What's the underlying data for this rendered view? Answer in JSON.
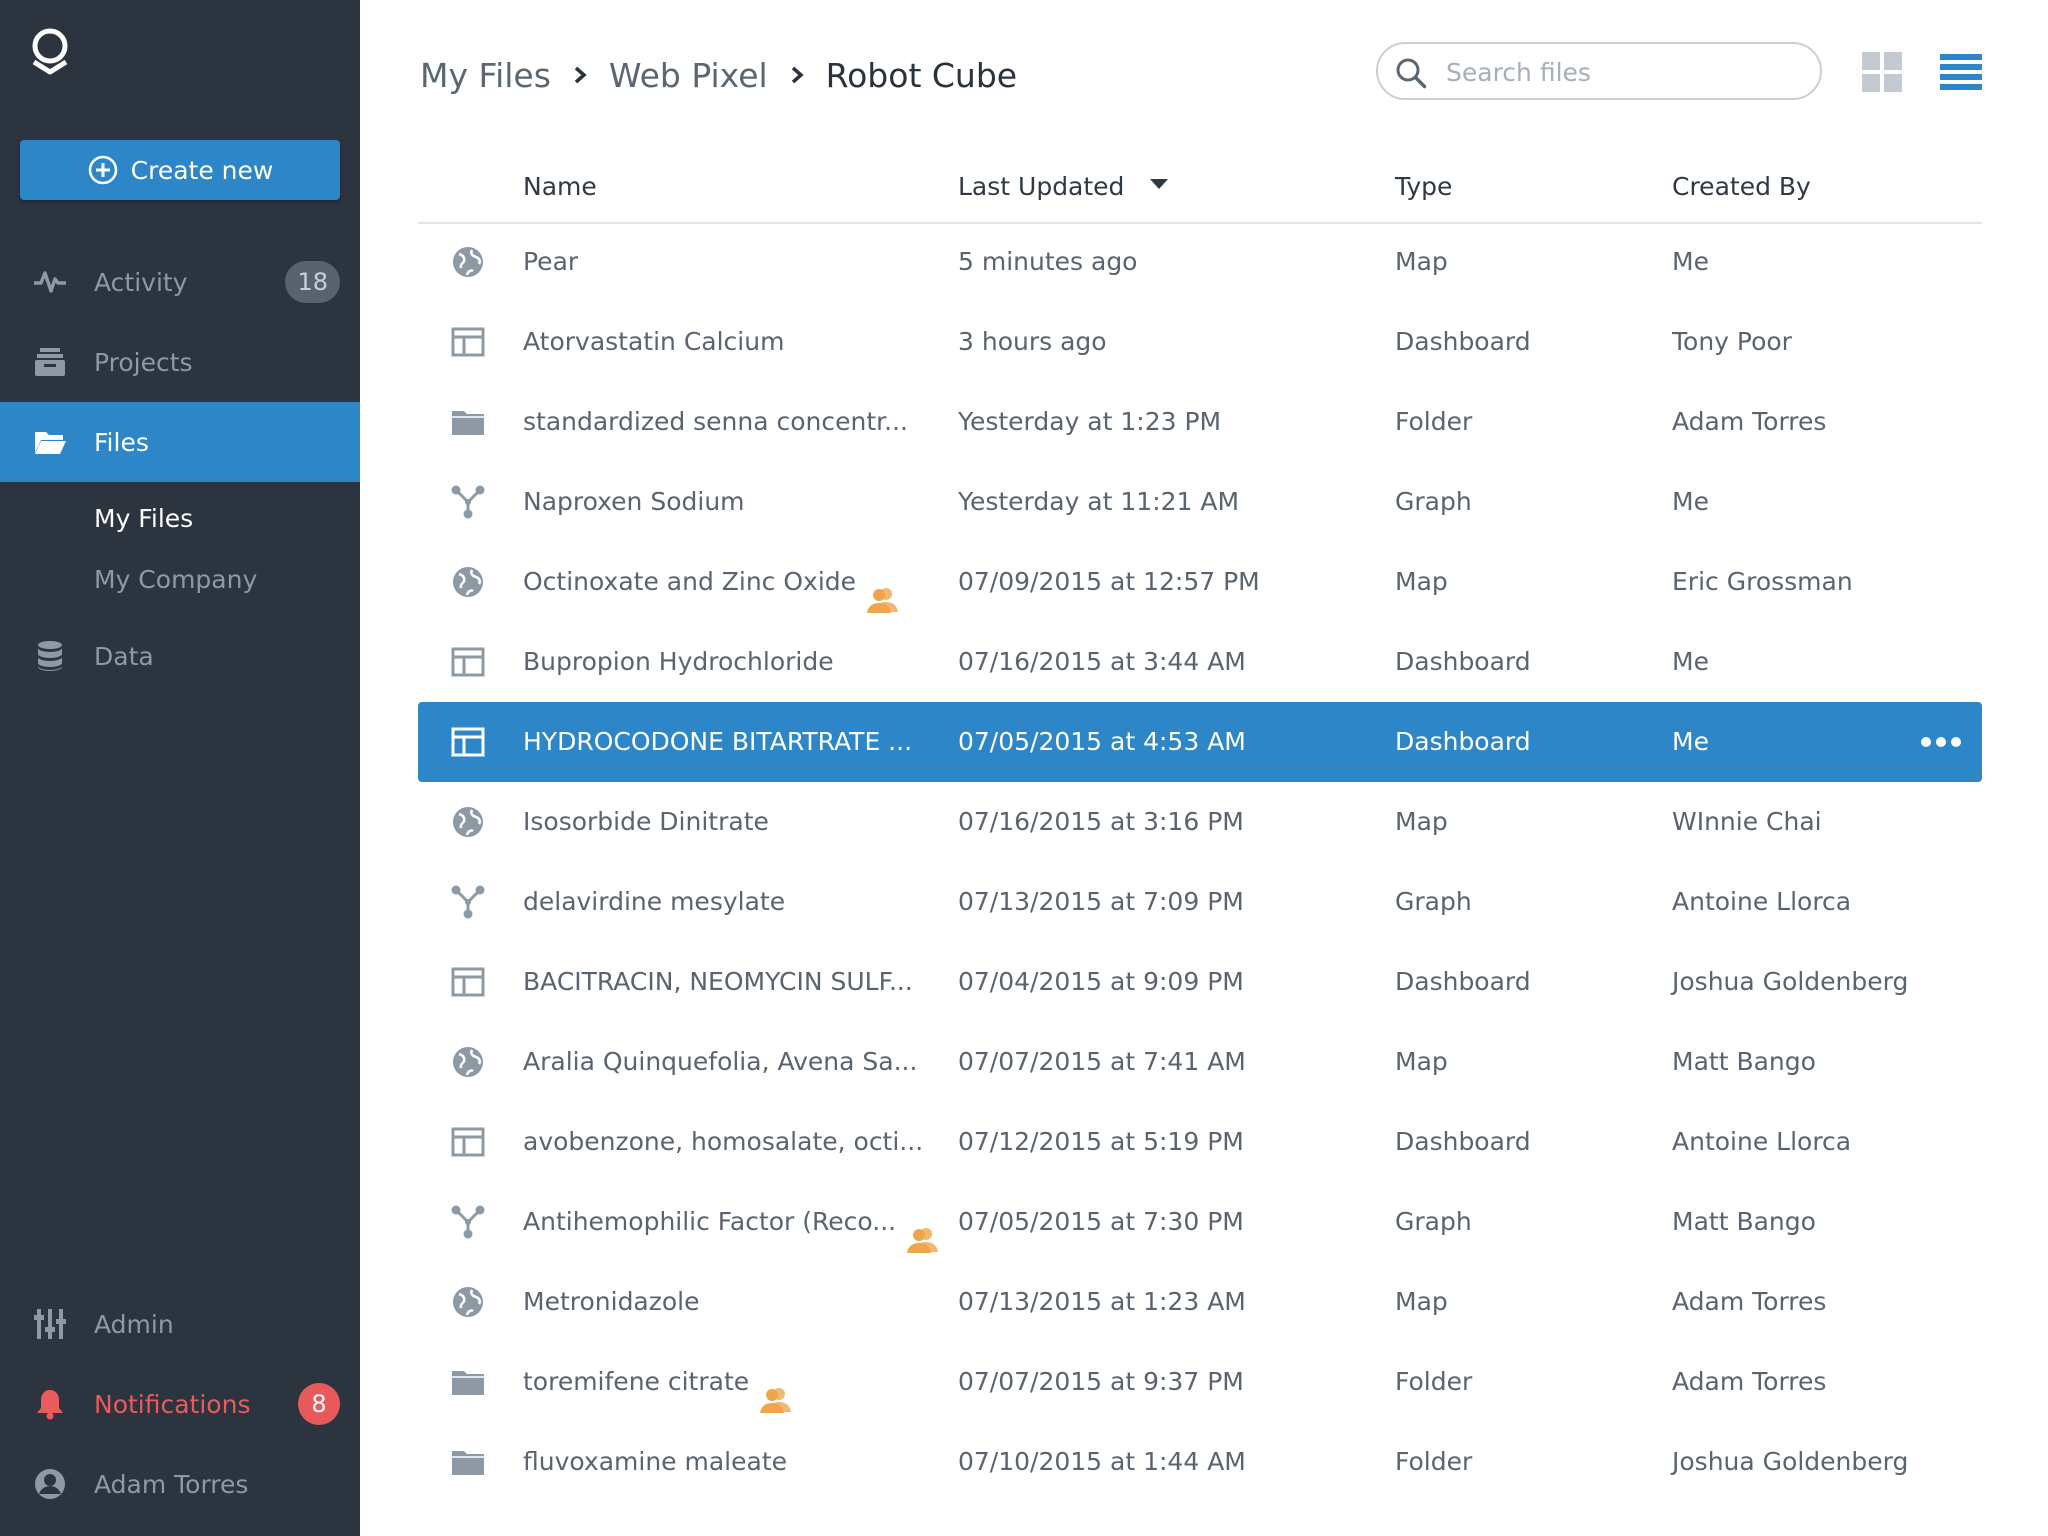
{
  "sidebar": {
    "create_label": "Create new",
    "nav": [
      {
        "label": "Activity",
        "icon": "pulse-icon",
        "badge": "18"
      },
      {
        "label": "Projects",
        "icon": "projects-icon"
      },
      {
        "label": "Files",
        "icon": "folder-open-icon",
        "active": true
      },
      {
        "label": "Data",
        "icon": "database-icon"
      }
    ],
    "files_sub": [
      {
        "label": "My Files",
        "current": true
      },
      {
        "label": "My Company"
      }
    ],
    "bottom": [
      {
        "label": "Admin",
        "icon": "sliders-icon"
      },
      {
        "label": "Notifications",
        "icon": "bell-icon",
        "badge": "8"
      },
      {
        "label": "Adam Torres",
        "icon": "user-avatar-icon"
      }
    ]
  },
  "breadcrumb": [
    "My Files",
    "Web Pixel",
    "Robot Cube"
  ],
  "search": {
    "placeholder": "Search files"
  },
  "table": {
    "headers": {
      "name": "Name",
      "updated": "Last Updated",
      "type": "Type",
      "by": "Created By"
    },
    "rows": [
      {
        "icon": "globe-icon",
        "name": "Pear",
        "updated": "5 minutes ago",
        "type": "Map",
        "by": "Me"
      },
      {
        "icon": "dashboard-icon",
        "name": "Atorvastatin Calcium",
        "updated": "3 hours ago",
        "type": "Dashboard",
        "by": "Tony Poor"
      },
      {
        "icon": "folder-icon",
        "name": "standardized senna concentr...",
        "updated": "Yesterday at 1:23 PM",
        "type": "Folder",
        "by": "Adam Torres"
      },
      {
        "icon": "graph-icon",
        "name": "Naproxen Sodium",
        "updated": "Yesterday at 11:21 AM",
        "type": "Graph",
        "by": "Me"
      },
      {
        "icon": "globe-icon",
        "name": "Octinoxate and Zinc Oxide",
        "shared": true,
        "updated": "07/09/2015 at 12:57 PM",
        "type": "Map",
        "by": "Eric Grossman"
      },
      {
        "icon": "dashboard-icon",
        "name": "Bupropion Hydrochloride",
        "updated": "07/16/2015 at 3:44 AM",
        "type": "Dashboard",
        "by": "Me"
      },
      {
        "icon": "dashboard-icon",
        "name": "HYDROCODONE BITARTRATE ...",
        "updated": "07/05/2015 at 4:53 AM",
        "type": "Dashboard",
        "by": "Me",
        "selected": true
      },
      {
        "icon": "globe-icon",
        "name": "Isosorbide Dinitrate",
        "updated": "07/16/2015 at 3:16 PM",
        "type": "Map",
        "by": "WInnie Chai"
      },
      {
        "icon": "graph-icon",
        "name": "delavirdine mesylate",
        "updated": "07/13/2015 at 7:09 PM",
        "type": "Graph",
        "by": "Antoine Llorca"
      },
      {
        "icon": "dashboard-icon",
        "name": "BACITRACIN, NEOMYCIN SULF...",
        "updated": "07/04/2015 at 9:09 PM",
        "type": "Dashboard",
        "by": "Joshua Goldenberg"
      },
      {
        "icon": "globe-icon",
        "name": "Aralia Quinquefolia, Avena Sa...",
        "updated": "07/07/2015 at 7:41 AM",
        "type": "Map",
        "by": "Matt Bango"
      },
      {
        "icon": "dashboard-icon",
        "name": "avobenzone, homosalate, octi...",
        "updated": "07/12/2015 at 5:19 PM",
        "type": "Dashboard",
        "by": "Antoine Llorca"
      },
      {
        "icon": "graph-icon",
        "name": "Antihemophilic Factor (Reco...",
        "shared": true,
        "updated": "07/05/2015 at 7:30 PM",
        "type": "Graph",
        "by": "Matt Bango"
      },
      {
        "icon": "globe-icon",
        "name": "Metronidazole",
        "updated": "07/13/2015 at 1:23 AM",
        "type": "Map",
        "by": "Adam Torres"
      },
      {
        "icon": "folder-icon",
        "name": "toremifene citrate",
        "shared": true,
        "updated": "07/07/2015 at 9:37 PM",
        "type": "Folder",
        "by": "Adam Torres"
      },
      {
        "icon": "folder-icon",
        "name": "fluvoxamine maleate",
        "updated": "07/10/2015 at 1:44 AM",
        "type": "Folder",
        "by": "Joshua Goldenberg"
      }
    ]
  },
  "colors": {
    "accent": "#2c86c7",
    "sidebar_bg": "#2c343f",
    "alert": "#e85a5a",
    "shared": "#f0a44b"
  }
}
